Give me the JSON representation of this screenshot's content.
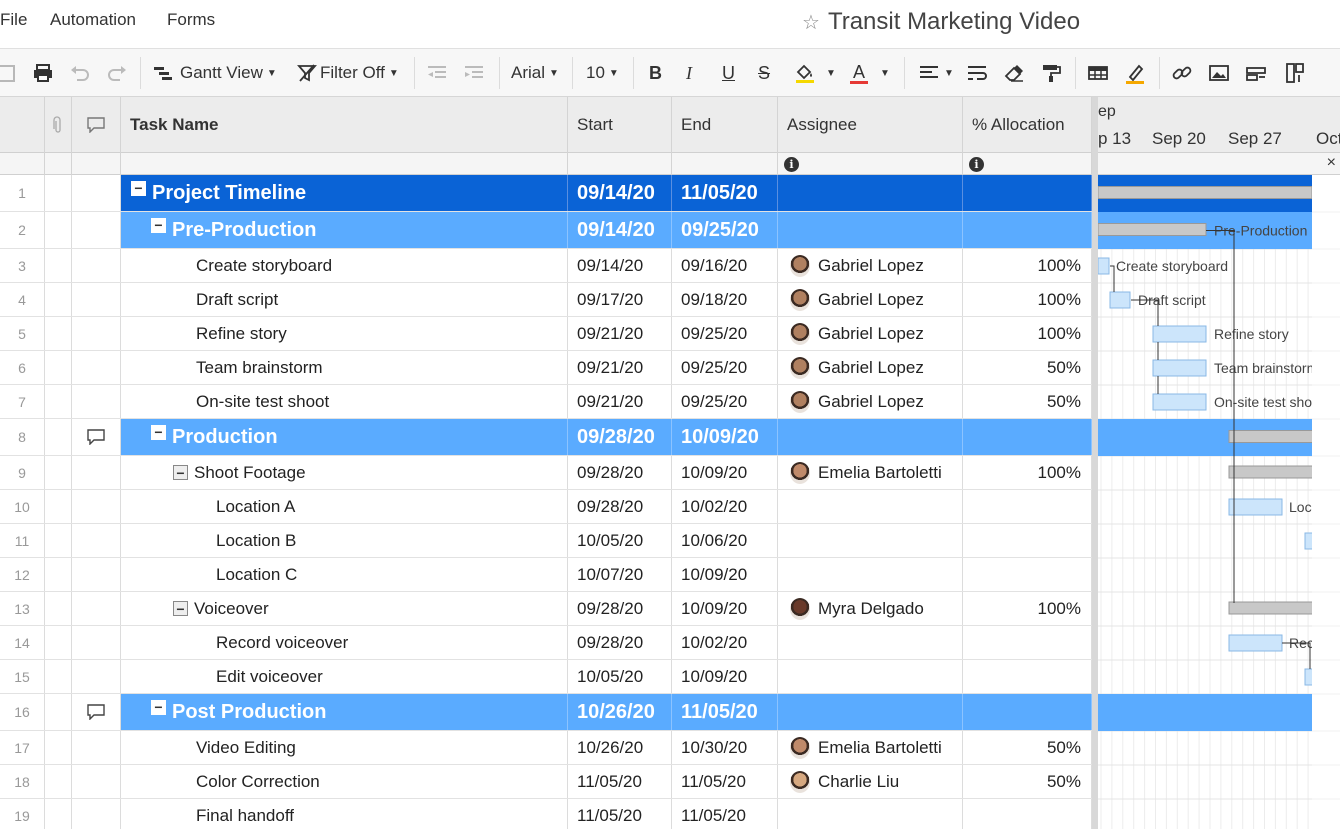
{
  "menu": {
    "file": "File",
    "automation": "Automation",
    "forms": "Forms"
  },
  "sheet_title": "Transit Marketing Video",
  "toolbar": {
    "view": "Gantt View",
    "filter": "Filter Off",
    "font": "Arial",
    "size": "10",
    "bold": "B",
    "italic": "I",
    "underline": "U",
    "strike": "S",
    "text_color": "A"
  },
  "columns": {
    "task_name": "Task Name",
    "start": "Start",
    "end": "End",
    "assignee": "Assignee",
    "allocation": "% Allocation"
  },
  "gantt": {
    "month_label": "ep",
    "weeks": [
      "p 13",
      "Sep 20",
      "Sep 27",
      "Oct"
    ],
    "close": "×"
  },
  "rows": [
    {
      "num": "1",
      "name": "Project Timeline",
      "start": "09/14/20",
      "end": "11/05/20",
      "assignee": "",
      "alloc": "",
      "level": 0,
      "indent": 0,
      "toggle": true,
      "comment": false
    },
    {
      "num": "2",
      "name": "Pre-Production",
      "start": "09/14/20",
      "end": "09/25/20",
      "assignee": "",
      "alloc": "",
      "level": 1,
      "indent": 1,
      "toggle": true,
      "comment": false
    },
    {
      "num": "3",
      "name": "Create storyboard",
      "start": "09/14/20",
      "end": "09/16/20",
      "assignee": "Gabriel Lopez",
      "alloc": "100%",
      "level": 2,
      "indent": 2,
      "toggle": false,
      "comment": false,
      "avatar": "#b08060"
    },
    {
      "num": "4",
      "name": "Draft script",
      "start": "09/17/20",
      "end": "09/18/20",
      "assignee": "Gabriel Lopez",
      "alloc": "100%",
      "level": 2,
      "indent": 2,
      "toggle": false,
      "comment": false,
      "avatar": "#b08060"
    },
    {
      "num": "5",
      "name": "Refine story",
      "start": "09/21/20",
      "end": "09/25/20",
      "assignee": "Gabriel Lopez",
      "alloc": "100%",
      "level": 2,
      "indent": 2,
      "toggle": false,
      "comment": false,
      "avatar": "#b08060"
    },
    {
      "num": "6",
      "name": "Team brainstorm",
      "start": "09/21/20",
      "end": "09/25/20",
      "assignee": "Gabriel Lopez",
      "alloc": "50%",
      "level": 2,
      "indent": 2,
      "toggle": false,
      "comment": false,
      "avatar": "#b08060"
    },
    {
      "num": "7",
      "name": "On-site test shoot",
      "start": "09/21/20",
      "end": "09/25/20",
      "assignee": "Gabriel Lopez",
      "alloc": "50%",
      "level": 2,
      "indent": 2,
      "toggle": false,
      "comment": false,
      "avatar": "#b08060"
    },
    {
      "num": "8",
      "name": "Production",
      "start": "09/28/20",
      "end": "10/09/20",
      "assignee": "",
      "alloc": "",
      "level": 1,
      "indent": 1,
      "toggle": true,
      "comment": true
    },
    {
      "num": "9",
      "name": "Shoot Footage",
      "start": "09/28/20",
      "end": "10/09/20",
      "assignee": "Emelia Bartoletti",
      "alloc": "100%",
      "level": 2,
      "indent": 2,
      "toggle": true,
      "comment": false,
      "avatar": "#c08a6a"
    },
    {
      "num": "10",
      "name": "Location A",
      "start": "09/28/20",
      "end": "10/02/20",
      "assignee": "",
      "alloc": "",
      "level": 2,
      "indent": 3,
      "toggle": false,
      "comment": false
    },
    {
      "num": "11",
      "name": "Location B",
      "start": "10/05/20",
      "end": "10/06/20",
      "assignee": "",
      "alloc": "",
      "level": 2,
      "indent": 3,
      "toggle": false,
      "comment": false
    },
    {
      "num": "12",
      "name": "Location C",
      "start": "10/07/20",
      "end": "10/09/20",
      "assignee": "",
      "alloc": "",
      "level": 2,
      "indent": 3,
      "toggle": false,
      "comment": false
    },
    {
      "num": "13",
      "name": "Voiceover",
      "start": "09/28/20",
      "end": "10/09/20",
      "assignee": "Myra Delgado",
      "alloc": "100%",
      "level": 2,
      "indent": 2,
      "toggle": true,
      "comment": false,
      "avatar": "#6a3a2a"
    },
    {
      "num": "14",
      "name": "Record voiceover",
      "start": "09/28/20",
      "end": "10/02/20",
      "assignee": "",
      "alloc": "",
      "level": 2,
      "indent": 3,
      "toggle": false,
      "comment": false
    },
    {
      "num": "15",
      "name": "Edit voiceover",
      "start": "10/05/20",
      "end": "10/09/20",
      "assignee": "",
      "alloc": "",
      "level": 2,
      "indent": 3,
      "toggle": false,
      "comment": false
    },
    {
      "num": "16",
      "name": "Post Production",
      "start": "10/26/20",
      "end": "11/05/20",
      "assignee": "",
      "alloc": "",
      "level": 1,
      "indent": 1,
      "toggle": true,
      "comment": true
    },
    {
      "num": "17",
      "name": "Video Editing",
      "start": "10/26/20",
      "end": "10/30/20",
      "assignee": "Emelia Bartoletti",
      "alloc": "50%",
      "level": 2,
      "indent": 2,
      "toggle": false,
      "comment": false,
      "avatar": "#c08a6a"
    },
    {
      "num": "18",
      "name": "Color Correction",
      "start": "11/05/20",
      "end": "11/05/20",
      "assignee": "Charlie Liu",
      "alloc": "50%",
      "level": 2,
      "indent": 2,
      "toggle": false,
      "comment": false,
      "avatar": "#d6a880"
    },
    {
      "num": "19",
      "name": "Final handoff",
      "start": "11/05/20",
      "end": "11/05/20",
      "assignee": "",
      "alloc": "",
      "level": 2,
      "indent": 2,
      "toggle": false,
      "comment": false
    }
  ],
  "gantt_labels": {
    "pre_production": "Pre-Production",
    "create_storyboard": "Create storyboard",
    "draft_script": "Draft script",
    "refine_story": "Refine story",
    "team_brainstorm": "Team brainstorm",
    "onsite": "On-site test shoot",
    "loc": "Loc",
    "rec": "Rec"
  },
  "colors": {
    "project_row": "#0a63d6",
    "phase_row": "#5aabff",
    "bar_task": "#cce5fb",
    "bar_summary": "#c8c8c8"
  }
}
